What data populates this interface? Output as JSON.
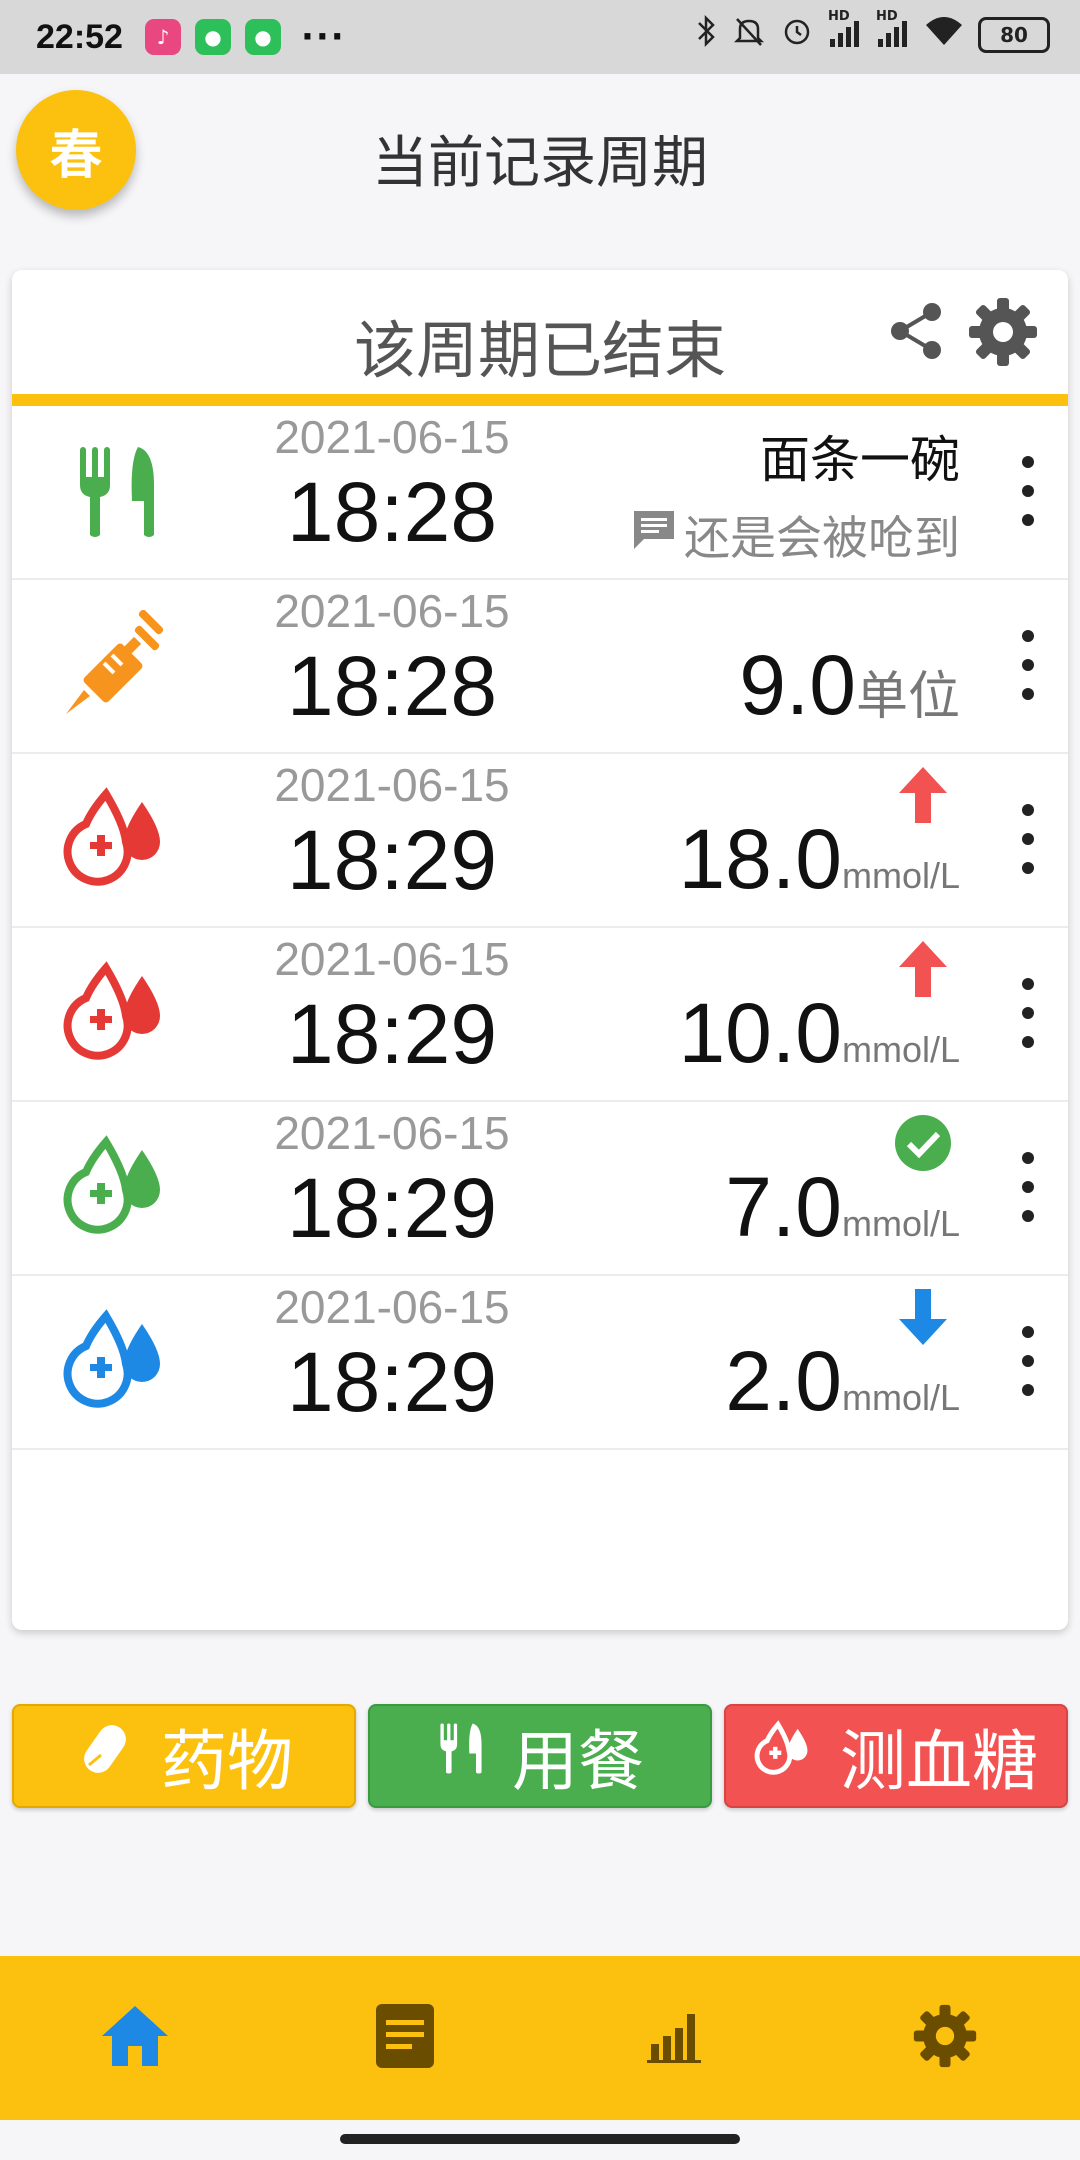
{
  "status_bar": {
    "time": "22:52",
    "notif_apps": [
      "MUSIC",
      "WeChat",
      "WeChat"
    ],
    "more": "···",
    "battery": "80",
    "hd_tag": "HD"
  },
  "header": {
    "avatar_label": "春",
    "title": "当前记录周期"
  },
  "card": {
    "title": "该周期已结束",
    "records": [
      {
        "type": "meal",
        "date": "2021-06-15",
        "time": "18:28",
        "name": "面条一碗",
        "note": "还是会被呛到",
        "icon": "utensils-icon",
        "color": "#4aae4f"
      },
      {
        "type": "insulin",
        "date": "2021-06-15",
        "time": "18:28",
        "value": "9.0",
        "unit": "单位",
        "icon": "syringe-icon",
        "color": "#f7941d"
      },
      {
        "type": "glucose",
        "date": "2021-06-15",
        "time": "18:29",
        "value": "18.0",
        "unit": "mmol/L",
        "status": "high",
        "icon": "blood-drop-icon",
        "color": "#e53935"
      },
      {
        "type": "glucose",
        "date": "2021-06-15",
        "time": "18:29",
        "value": "10.0",
        "unit": "mmol/L",
        "status": "high",
        "icon": "blood-drop-icon",
        "color": "#e53935"
      },
      {
        "type": "glucose",
        "date": "2021-06-15",
        "time": "18:29",
        "value": "7.0",
        "unit": "mmol/L",
        "status": "normal",
        "icon": "blood-drop-icon",
        "color": "#4aae4f"
      },
      {
        "type": "glucose",
        "date": "2021-06-15",
        "time": "18:29",
        "value": "2.0",
        "unit": "mmol/L",
        "status": "low",
        "icon": "blood-drop-icon",
        "color": "#1e88e5"
      }
    ]
  },
  "actions": {
    "medicine": "药物",
    "meal": "用餐",
    "glucose": "测血糖"
  },
  "bottom_nav": [
    "home-icon",
    "list-icon",
    "chart-icon",
    "settings-icon"
  ],
  "colors": {
    "accent": "#fcc10f",
    "green": "#4aae4f",
    "red": "#f35252",
    "blue": "#1e88e5",
    "orange": "#f7941d"
  }
}
